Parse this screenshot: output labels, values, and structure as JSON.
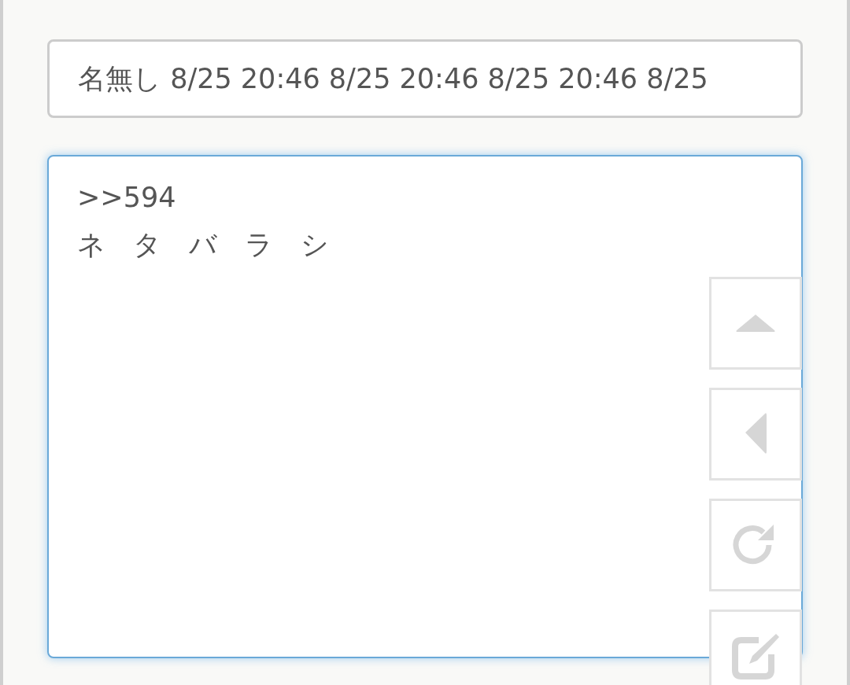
{
  "name_field": {
    "value": "名無し 8/25 20:46 8/25 20:46 8/25 20:46 8/25"
  },
  "message_field": {
    "value": ">>594\nネ　タ　バ　ラ　シ"
  },
  "side_buttons": [
    {
      "kind": "up"
    },
    {
      "kind": "back"
    },
    {
      "kind": "refresh"
    },
    {
      "kind": "edit"
    }
  ]
}
